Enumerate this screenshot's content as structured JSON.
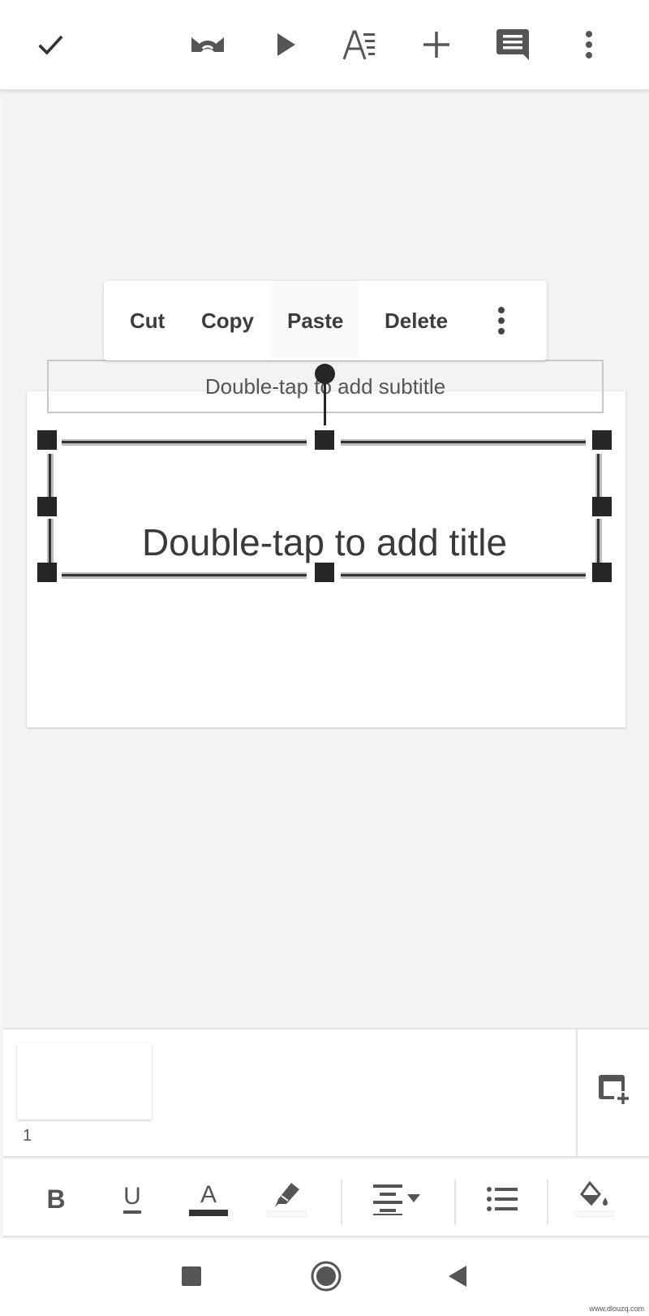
{
  "toolbar": {
    "done_icon": "check-icon",
    "transition_icon": "transition-icon",
    "present_icon": "play-icon",
    "format_icon": "text-format-icon",
    "insert_icon": "plus-icon",
    "comment_icon": "comment-icon",
    "more_icon": "more-vert-icon"
  },
  "context_menu": {
    "items": [
      {
        "label": "Cut"
      },
      {
        "label": "Copy"
      },
      {
        "label": "Paste"
      },
      {
        "label": "Delete"
      }
    ],
    "more_icon": "more-vert-icon"
  },
  "slide": {
    "subtitle_placeholder": "Double-tap to add subtitle",
    "title_placeholder": "Double-tap to add title"
  },
  "filmstrip": {
    "slides": [
      {
        "number": "1"
      }
    ],
    "new_slide_icon": "new-slide-icon"
  },
  "format_bar": {
    "bold": "B",
    "underline": "U",
    "text_color": "A",
    "highlight_icon": "highlighter-icon",
    "align_icon": "align-center-icon",
    "list_icon": "bulleted-list-icon",
    "fill_icon": "fill-color-icon"
  },
  "nav": {
    "recents_icon": "square-icon",
    "home_icon": "circle-icon",
    "back_icon": "triangle-back-icon"
  },
  "watermark": "www.dlouzq.com"
}
